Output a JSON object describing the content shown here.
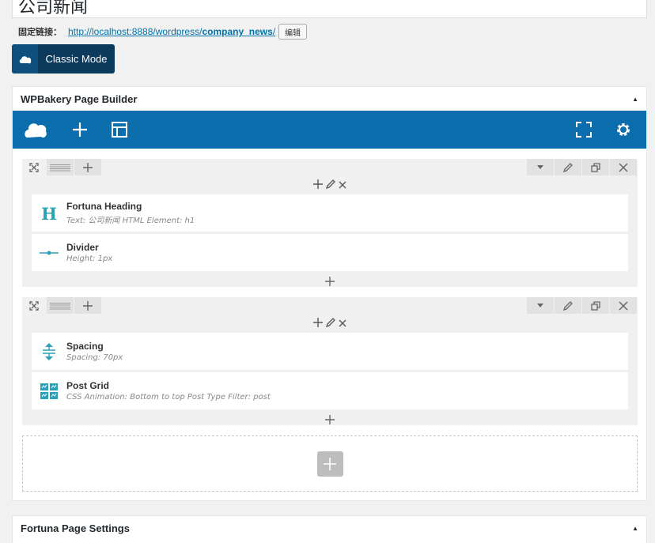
{
  "title_field": {
    "value": "公司新闻"
  },
  "permalink": {
    "label": "固定链接：",
    "url_prefix": "http://localhost:8888/wordpress/",
    "url_slug": "company_news",
    "url_suffix": "/",
    "edit_label": "编辑"
  },
  "classic_mode": {
    "label": "Classic Mode"
  },
  "wpbakery": {
    "title": "WPBakery Page Builder",
    "toggle": "▲",
    "accent_color": "#0b6dab",
    "rows": [
      {
        "elements": [
          {
            "name": "Fortuna Heading",
            "desc": "Text: 公司新闻  HTML Element: h1",
            "icon": "heading-icon"
          },
          {
            "name": "Divider",
            "desc": "Height: 1px",
            "icon": "divider-icon"
          }
        ]
      },
      {
        "elements": [
          {
            "name": "Spacing",
            "desc": "Spacing: 70px",
            "icon": "spacing-icon"
          },
          {
            "name": "Post Grid",
            "desc": "CSS Animation: Bottom to top  Post Type Filter: post",
            "icon": "post-grid-icon"
          }
        ]
      }
    ]
  },
  "fortuna_settings": {
    "title": "Fortuna Page Settings",
    "toggle": "▲"
  }
}
